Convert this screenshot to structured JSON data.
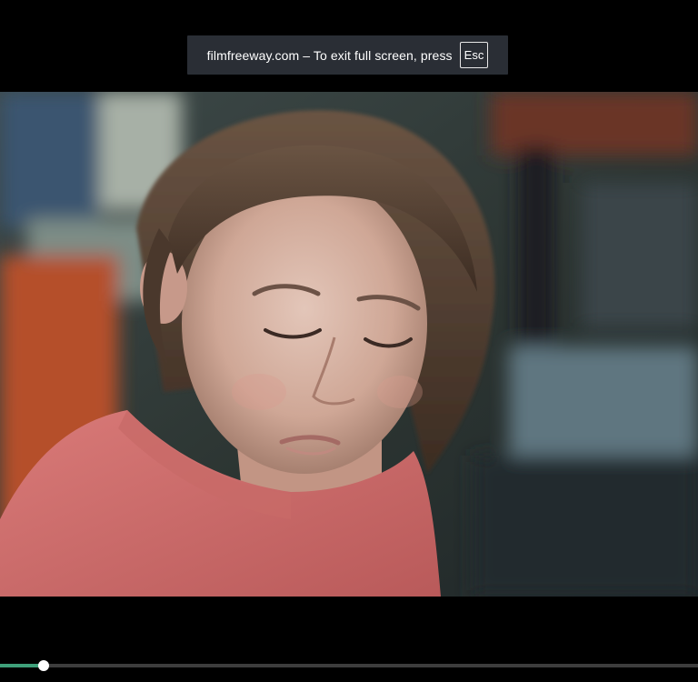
{
  "fullscreen_toast": {
    "message": "filmfreeway.com – To exit full screen, press",
    "key_label": "Esc"
  },
  "player": {
    "progress": 0.063,
    "colors": {
      "progress_fill": "#3fa07a",
      "track": "#3d3d3d",
      "thumb": "#ffffff",
      "toast_bg": "#2a2e35"
    }
  }
}
